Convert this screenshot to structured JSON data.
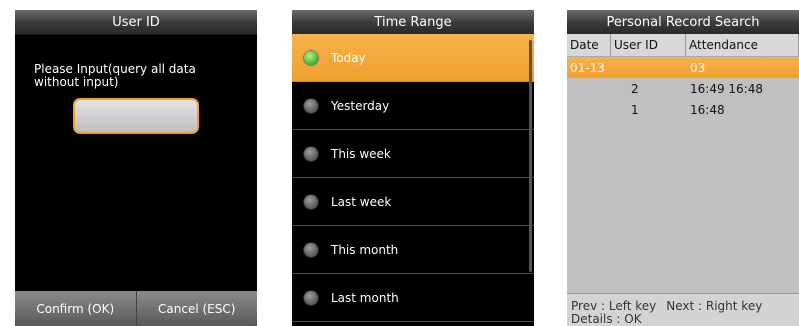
{
  "screen1": {
    "title": "User ID",
    "prompt": "Please Input(query all data without input)",
    "input_value": "",
    "confirm_label": "Confirm (OK)",
    "cancel_label": "Cancel (ESC)"
  },
  "screen2": {
    "title": "Time Range",
    "options": [
      {
        "label": "Today",
        "selected": true
      },
      {
        "label": "Yesterday",
        "selected": false
      },
      {
        "label": "This week",
        "selected": false
      },
      {
        "label": "Last week",
        "selected": false
      },
      {
        "label": "This month",
        "selected": false
      },
      {
        "label": "Last month",
        "selected": false
      }
    ]
  },
  "screen3": {
    "title": "Personal Record Search",
    "columns": [
      "Date",
      "User ID",
      "Attendance"
    ],
    "rows": [
      {
        "date": "01-13",
        "user_id": "",
        "attendance": "03",
        "selected": true
      },
      {
        "date": "",
        "user_id": "2",
        "attendance": "16:49 16:48",
        "selected": false
      },
      {
        "date": "",
        "user_id": "1",
        "attendance": "16:48",
        "selected": false
      }
    ],
    "footer": {
      "prev": "Prev : Left key",
      "next": "Next : Right key",
      "details": "Details : OK"
    }
  },
  "colors": {
    "accent": "#f0a030",
    "radio_selected": "#5cc23a",
    "screen_bg": "#000000",
    "table_bg": "#c0c0c0"
  }
}
